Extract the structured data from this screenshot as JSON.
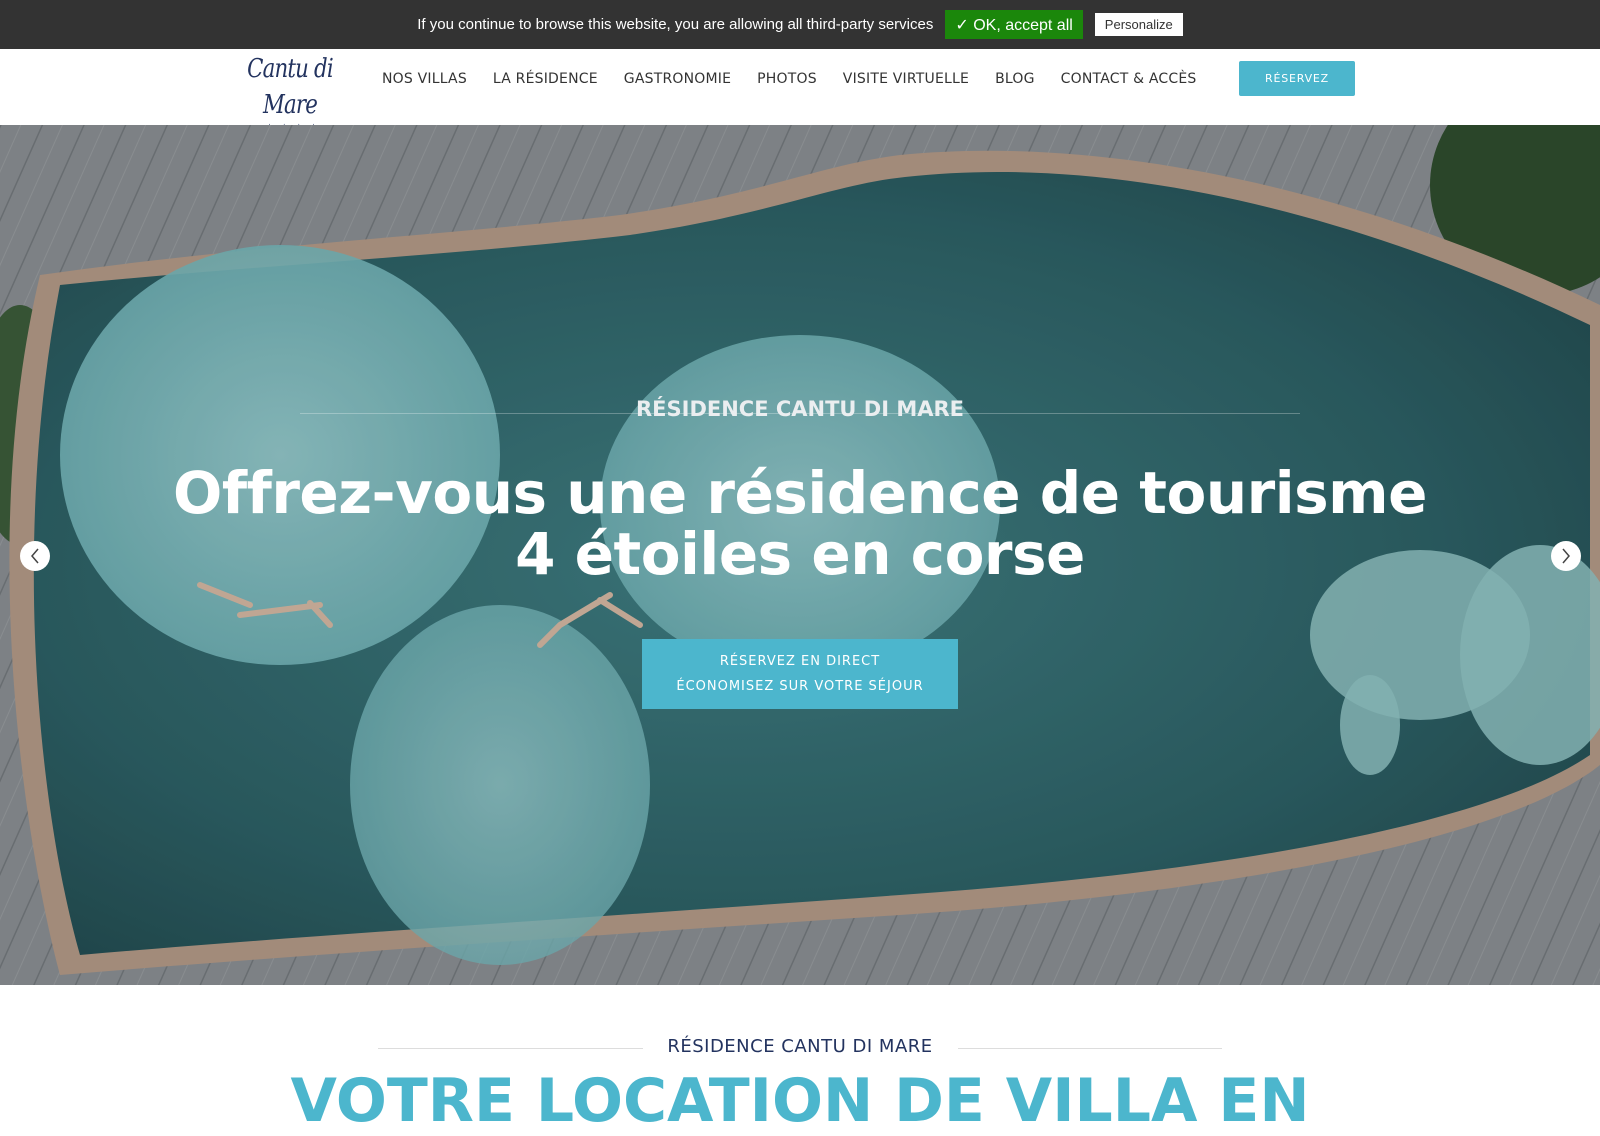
{
  "cookie_bar": {
    "message": "If you continue to browse this website, you are allowing all third-party services",
    "accept_label": "✓ OK, accept all",
    "personalize_label": "Personalize"
  },
  "header": {
    "logo_text": "Cantu di Mare",
    "logo_stars": "★★★★",
    "nav": [
      {
        "label": "NOS VILLAS"
      },
      {
        "label": "LA RÉSIDENCE"
      },
      {
        "label": "GASTRONOMIE"
      },
      {
        "label": "PHOTOS"
      },
      {
        "label": "VISITE VIRTUELLE"
      },
      {
        "label": "BLOG"
      },
      {
        "label": "CONTACT & ACCÈS"
      }
    ],
    "cta_label": "RÉSERVEZ"
  },
  "hero": {
    "kicker": "RÉSIDENCE CANTU DI MARE",
    "title": "Offrez-vous une résidence de tourisme 4 étoiles en corse",
    "cta_line1": "RÉSERVEZ EN DIRECT",
    "cta_line2": "ÉCONOMISEZ SUR VOTRE SÉJOUR",
    "prev_icon": "chevron-left-icon",
    "next_icon": "chevron-right-icon"
  },
  "section": {
    "kicker": "RÉSIDENCE CANTU DI MARE",
    "title": "VOTRE LOCATION DE VILLA EN"
  },
  "colors": {
    "accent": "#4cb6cd",
    "navy": "#23335f",
    "cookie_bg": "#333333",
    "cookie_accept": "#1b870b"
  }
}
